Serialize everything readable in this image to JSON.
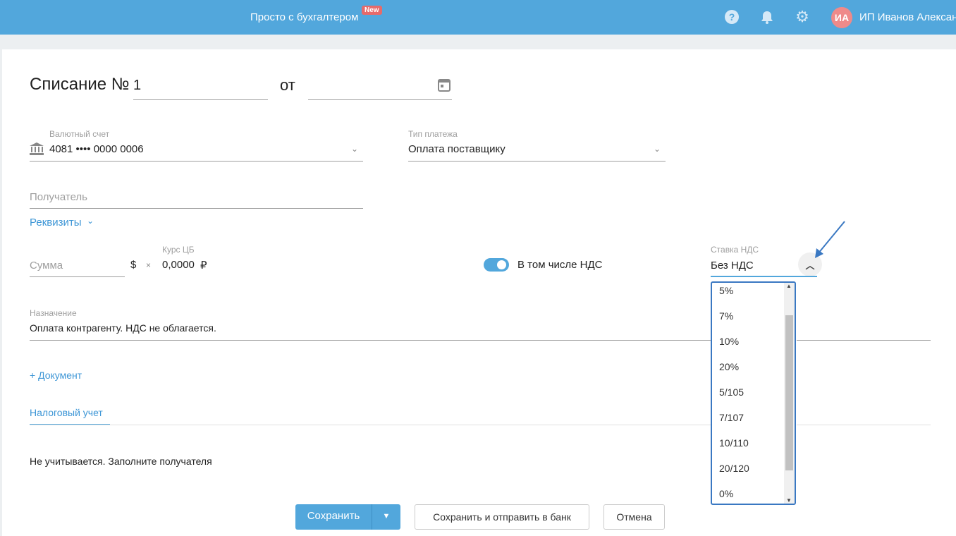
{
  "header": {
    "brand": "Просто с бухгалтером",
    "badge": "New",
    "avatar": "ИА",
    "user": "ИП Иванов Алексан"
  },
  "form": {
    "title": "Списание №",
    "number": "1",
    "from": "от",
    "account": {
      "label": "Валютный счет",
      "value": "4081 •••• 0000 0006"
    },
    "payment_type": {
      "label": "Тип платежа",
      "value": "Оплата поставщику"
    },
    "recipient": {
      "placeholder": "Получатель"
    },
    "requisites": "Реквизиты",
    "amount": {
      "placeholder": "Сумма",
      "currency": "$",
      "times": "×"
    },
    "rate": {
      "label": "Курс ЦБ",
      "value": "0,0000",
      "currency": "₽"
    },
    "vat_toggle": {
      "label": "В том числе НДС",
      "on": true
    },
    "vat_rate": {
      "label": "Ставка НДС",
      "value": "Без НДС",
      "options": [
        "5%",
        "7%",
        "10%",
        "20%",
        "5/105",
        "7/107",
        "10/110",
        "20/120",
        "0%"
      ]
    },
    "purpose": {
      "label": "Назначение",
      "value": "Оплата контрагенту. НДС не облагается."
    },
    "add_document": "+ Документ",
    "tab": "Налоговый учет",
    "tax_note": "Не учитывается. Заполните получателя"
  },
  "buttons": {
    "save": "Сохранить",
    "save_send": "Сохранить и отправить в банк",
    "cancel": "Отмена"
  }
}
